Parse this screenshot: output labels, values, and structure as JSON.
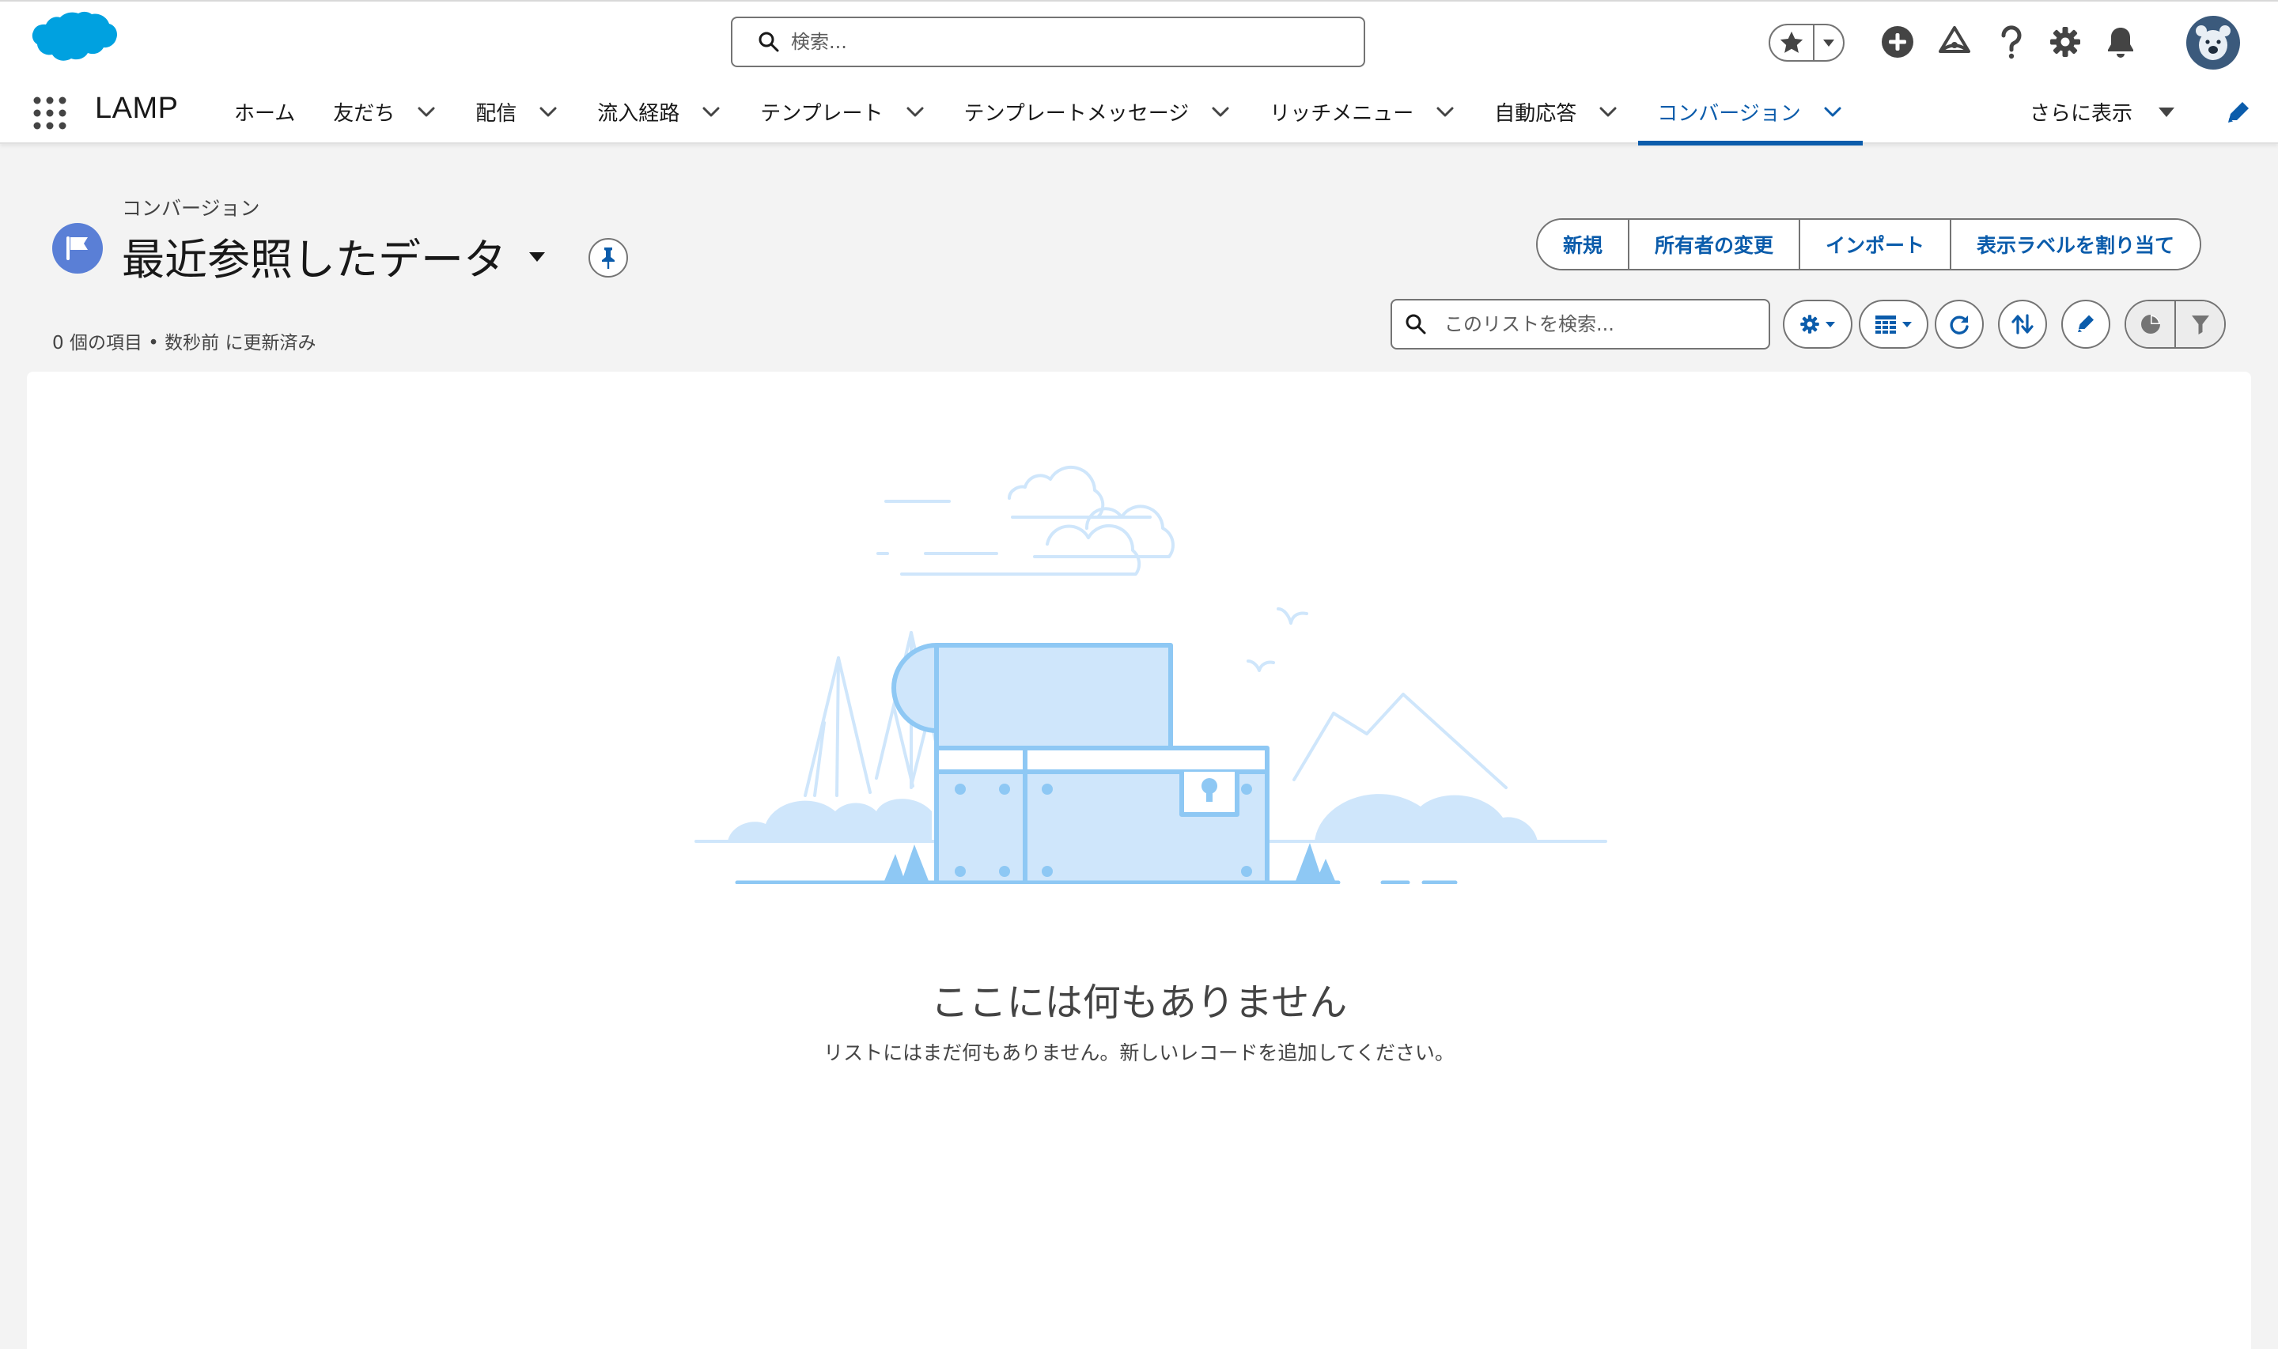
{
  "header": {
    "search_placeholder": "検索..."
  },
  "nav": {
    "app_name": "LAMP",
    "items": [
      {
        "label": "ホーム",
        "has_menu": false
      },
      {
        "label": "友だち",
        "has_menu": true
      },
      {
        "label": "配信",
        "has_menu": true
      },
      {
        "label": "流入経路",
        "has_menu": true
      },
      {
        "label": "テンプレート",
        "has_menu": true
      },
      {
        "label": "テンプレートメッセージ",
        "has_menu": true
      },
      {
        "label": "リッチメニュー",
        "has_menu": true
      },
      {
        "label": "自動応答",
        "has_menu": true
      },
      {
        "label": "コンバージョン",
        "has_menu": true,
        "active": true
      }
    ],
    "more_label": "さらに表示"
  },
  "list_header": {
    "object_label": "コンバージョン",
    "list_view_title": "最近参照したデータ",
    "meta": "0 個の項目 • 数秒前 に更新済み",
    "actions": {
      "new": "新規",
      "change_owner": "所有者の変更",
      "import": "インポート",
      "assign_label": "表示ラベルを割り当て"
    },
    "search_placeholder": "このリストを検索..."
  },
  "empty_state": {
    "title": "ここには何もありません",
    "body": "リストにはまだ何もありません。新しいレコードを追加してください。"
  },
  "colors": {
    "brand_blue": "#0b5cab",
    "salesforce_cloud": "#00a1e0",
    "object_icon": "#5a7fd6",
    "illustration_fill": "#cfe6fb",
    "illustration_stroke": "#8ec8f4"
  }
}
